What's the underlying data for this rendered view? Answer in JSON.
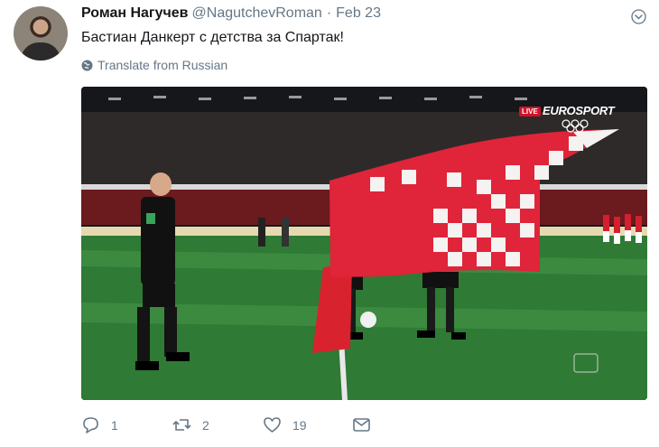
{
  "author": {
    "name": "Роман Нагучев",
    "handle": "@NagutchevRoman",
    "separator": "·",
    "date": "Feb 23"
  },
  "tweet": {
    "text": "Бастиан Данкерт с детства за Спартак!",
    "translate_label": "Translate from Russian"
  },
  "media": {
    "live_badge": "LIVE",
    "channel_logo": "EUROSPORT"
  },
  "actions": {
    "reply_count": "1",
    "retweet_count": "2",
    "like_count": "19"
  },
  "icons": {
    "reply": "reply-icon",
    "retweet": "retweet-icon",
    "like": "heart-icon",
    "message": "envelope-icon",
    "caret": "chevron-down-icon",
    "globe": "globe-icon"
  },
  "colors": {
    "text": "#14171a",
    "secondary": "#657786",
    "flag_red": "#e0243a"
  }
}
